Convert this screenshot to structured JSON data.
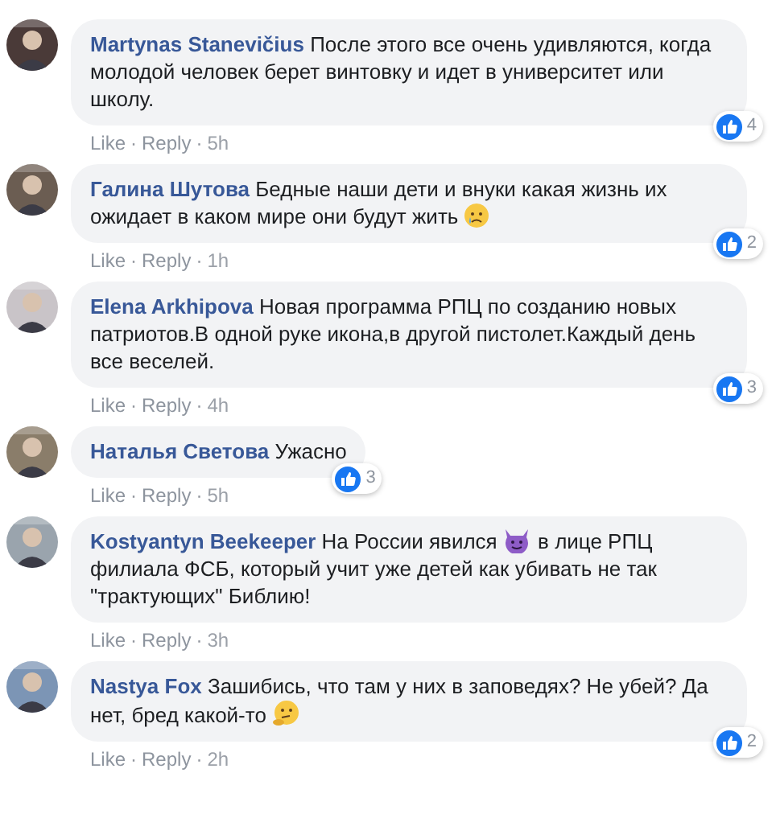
{
  "comments": [
    {
      "author": "Martynas Stanevičius",
      "body": [
        {
          "kind": "text",
          "text": "После этого все очень удивляются, когда молодой человек берет винтовку и идет в университет или школу."
        }
      ],
      "actions": [
        {
          "kind": "link",
          "text": "Like"
        },
        {
          "kind": "separator",
          "text": "·"
        },
        {
          "kind": "link",
          "text": "Reply"
        },
        {
          "kind": "separator",
          "text": "·"
        },
        {
          "kind": "time",
          "text": "5h"
        }
      ],
      "reactions": "4"
    },
    {
      "author": "Галина Шутова",
      "body": [
        {
          "kind": "text",
          "text": "Бедные наши дети и внуки какая жизнь их ожидает в каком мире они будут жить "
        },
        {
          "kind": "sad-emoji"
        }
      ],
      "actions": [
        {
          "kind": "link",
          "text": "Like"
        },
        {
          "kind": "separator",
          "text": "·"
        },
        {
          "kind": "link",
          "text": "Reply"
        },
        {
          "kind": "separator",
          "text": "·"
        },
        {
          "kind": "time",
          "text": "1h"
        }
      ],
      "reactions": "2"
    },
    {
      "author": "Elena Arkhipova",
      "body": [
        {
          "kind": "text",
          "text": "Новая программа РПЦ по созданию новых патриотов.В одной руке икона,в другой пистолет.Каждый день все веселей."
        }
      ],
      "actions": [
        {
          "kind": "link",
          "text": "Like"
        },
        {
          "kind": "separator",
          "text": "·"
        },
        {
          "kind": "link",
          "text": "Reply"
        },
        {
          "kind": "separator",
          "text": "·"
        },
        {
          "kind": "time",
          "text": "4h"
        }
      ],
      "reactions": "3"
    },
    {
      "author": "Наталья Светова",
      "body": [
        {
          "kind": "text",
          "text": "Ужасно"
        }
      ],
      "actions": [
        {
          "kind": "link",
          "text": "Like"
        },
        {
          "kind": "separator",
          "text": "·"
        },
        {
          "kind": "link",
          "text": "Reply"
        },
        {
          "kind": "separator",
          "text": "·"
        },
        {
          "kind": "time",
          "text": "5h"
        }
      ],
      "reactions": "3"
    },
    {
      "author": "Kostyantyn Beekeeper",
      "body": [
        {
          "kind": "text",
          "text": "На России явился "
        },
        {
          "kind": "devil-emoji"
        },
        {
          "kind": "text",
          "text": " в лице РПЦ филиала ФСБ, который учит уже детей как убивать не так \"трактующих\" Библию!"
        }
      ],
      "actions": [
        {
          "kind": "link",
          "text": "Like"
        },
        {
          "kind": "separator",
          "text": "·"
        },
        {
          "kind": "link",
          "text": "Reply"
        },
        {
          "kind": "separator",
          "text": "·"
        },
        {
          "kind": "time",
          "text": "3h"
        }
      ]
    },
    {
      "author": "Nastya Fox",
      "body": [
        {
          "kind": "text",
          "text": "Зашибись, что там у них в заповедях? Не убей? Да нет, бред какой-то "
        },
        {
          "kind": "thinking-emoji"
        }
      ],
      "actions": [
        {
          "kind": "link",
          "text": "Like"
        },
        {
          "kind": "separator",
          "text": "·"
        },
        {
          "kind": "link",
          "text": "Reply"
        },
        {
          "kind": "separator",
          "text": "·"
        },
        {
          "kind": "time",
          "text": "2h"
        }
      ],
      "reactions": "2"
    }
  ]
}
